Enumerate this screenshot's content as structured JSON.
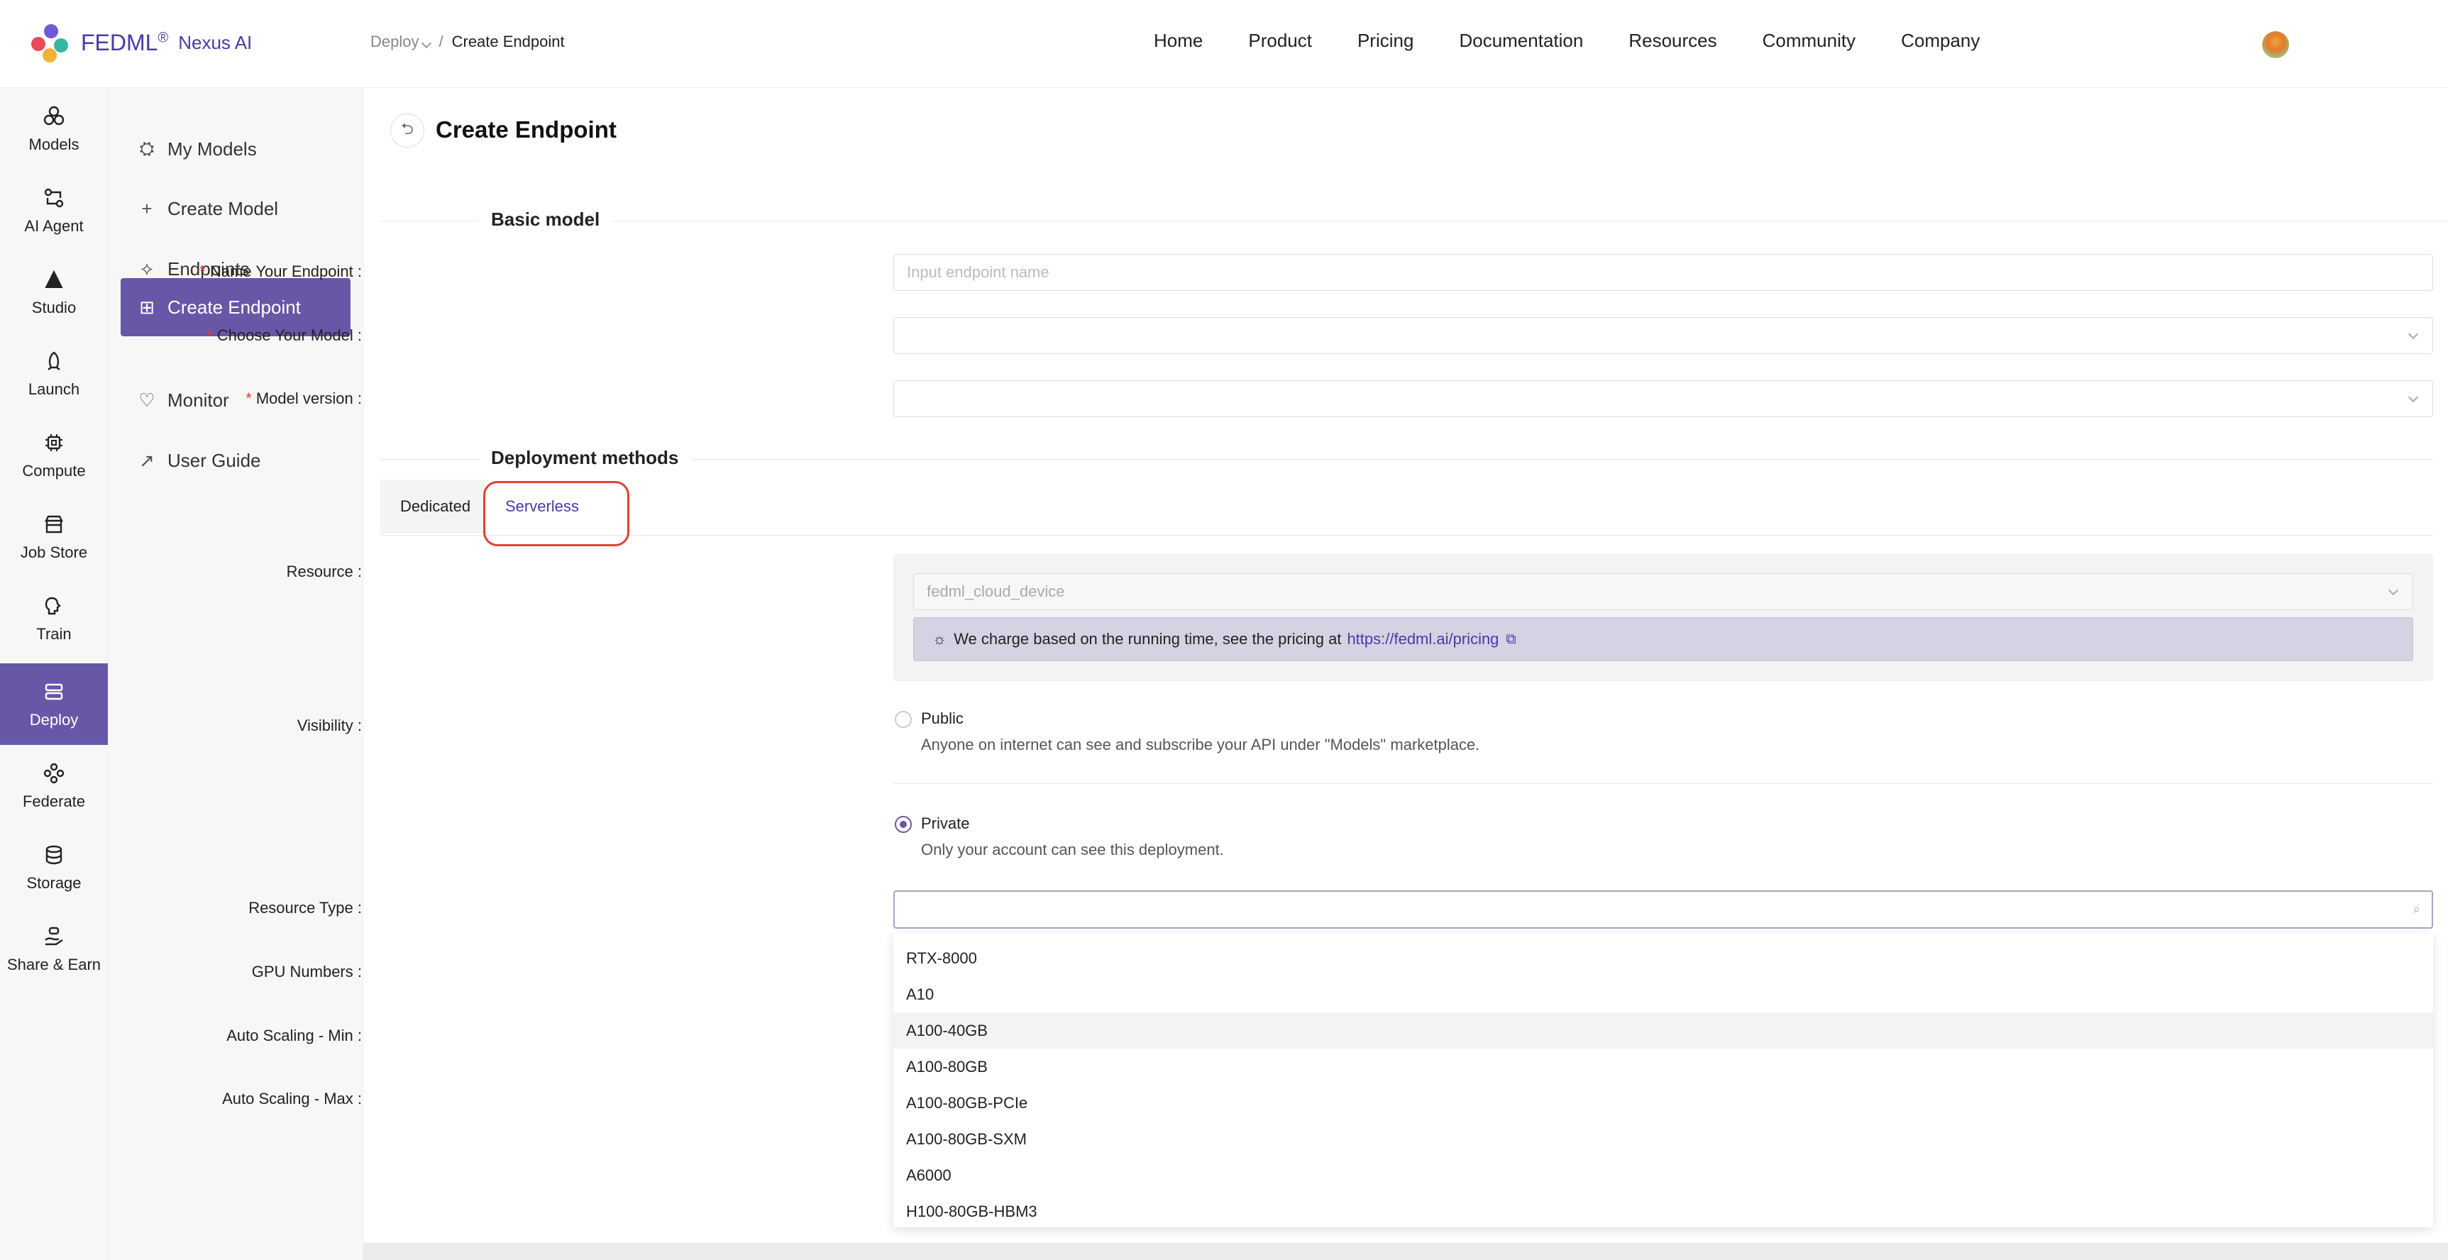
{
  "brand": {
    "name": "FEDML",
    "mark": "®",
    "sub": "Nexus AI"
  },
  "breadcrumb": {
    "parent": "Deploy",
    "separator": "/",
    "current": "Create Endpoint"
  },
  "topnav": [
    "Home",
    "Product",
    "Pricing",
    "Documentation",
    "Resources",
    "Community",
    "Company"
  ],
  "rail": [
    {
      "label": "Models",
      "icon": "models-icon"
    },
    {
      "label": "AI Agent",
      "icon": "ai-agent-icon"
    },
    {
      "label": "Studio",
      "icon": "studio-icon"
    },
    {
      "label": "Launch",
      "icon": "launch-icon"
    },
    {
      "label": "Compute",
      "icon": "compute-icon"
    },
    {
      "label": "Job Store",
      "icon": "job-store-icon"
    },
    {
      "label": "Train",
      "icon": "train-icon"
    },
    {
      "label": "Deploy",
      "icon": "deploy-icon",
      "active": true
    },
    {
      "label": "Federate",
      "icon": "federate-icon"
    },
    {
      "label": "Storage",
      "icon": "storage-icon"
    },
    {
      "label": "Share & Earn",
      "icon": "share-earn-icon"
    }
  ],
  "subnav": [
    {
      "label": "My Models",
      "icon": "models-icon",
      "glyph": "⛭"
    },
    {
      "label": "Create Model",
      "icon": "plus-icon",
      "glyph": "+"
    },
    {
      "label": "Endpoints",
      "icon": "endpoint-icon",
      "glyph": "⟡"
    },
    {
      "label": "Create Endpoint",
      "icon": "add-square-icon",
      "glyph": "⊞",
      "active": true
    },
    {
      "label": "Monitor",
      "icon": "monitor-icon",
      "glyph": "♡"
    },
    {
      "label": "User Guide",
      "icon": "guide-icon",
      "glyph": "↗"
    }
  ],
  "page": {
    "title": "Create Endpoint",
    "back_glyph": "⮌"
  },
  "basic": {
    "section_title": "Basic model",
    "name_label": "Name Your Endpoint",
    "name_placeholder": "Input endpoint name",
    "model_label": "Choose Your Model",
    "version_label": "Model version"
  },
  "deployment": {
    "section_title": "Deployment methods",
    "tabs": [
      "Dedicated",
      "Serverless"
    ],
    "active_tab": "Serverless",
    "resource_label": "Resource",
    "resource_value": "fedml_cloud_device",
    "note_text": "We charge based on the running time, see the pricing at",
    "note_link": "https://fedml.ai/pricing",
    "visibility_label": "Visibility",
    "public_title": "Public",
    "public_desc": "Anyone on internet can see and subscribe your API under \"Models\" marketplace.",
    "private_title": "Private",
    "private_desc": "Only your account can see this deployment.",
    "visibility_selected": "Private",
    "resource_type_label": "Resource Type",
    "gpu_label": "GPU Numbers",
    "scale_min_label": "Auto Scaling - Min",
    "scale_max_label": "Auto Scaling - Max",
    "resource_type_options": [
      "RTX-8000",
      "A10",
      "A100-40GB",
      "A100-80GB",
      "A100-80GB-PCIe",
      "A100-80GB-SXM",
      "A6000",
      "H100-80GB-HBM3"
    ],
    "hovered_option": "A100-40GB"
  },
  "colors": {
    "accent": "#6757a6",
    "link": "#4a3aa5",
    "required": "#e23b3b",
    "highlight": "#e0422e"
  }
}
